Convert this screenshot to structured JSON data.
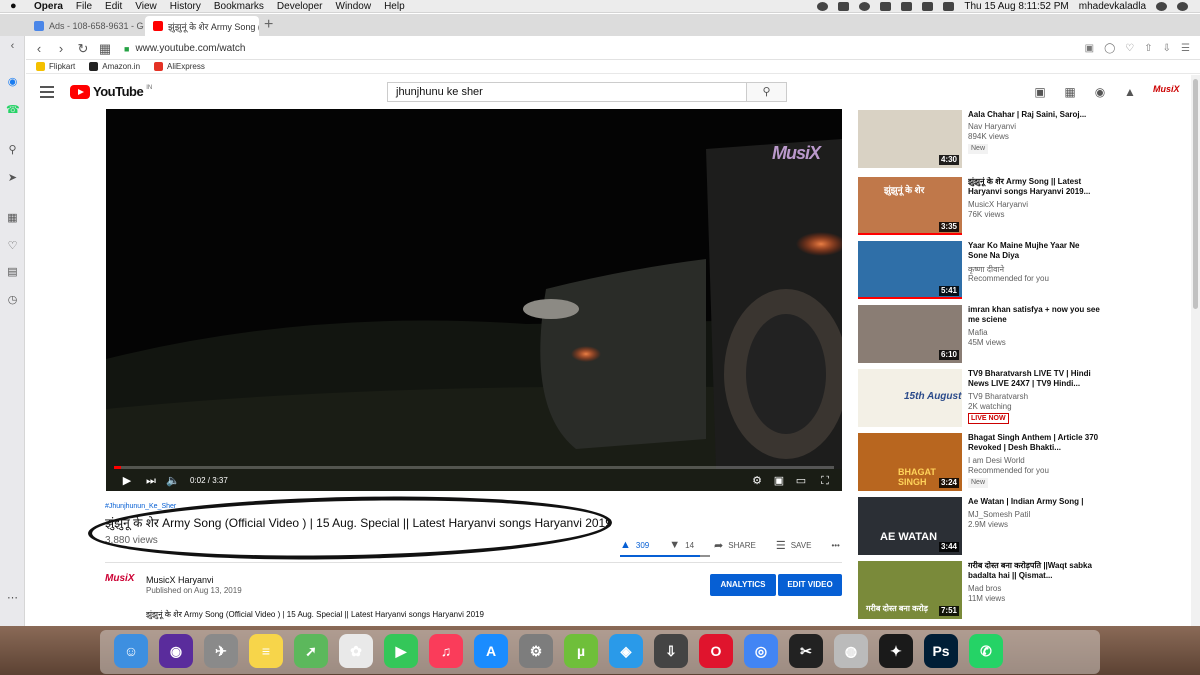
{
  "menubar": {
    "items": [
      "Opera",
      "File",
      "Edit",
      "View",
      "History",
      "Bookmarks",
      "Developer",
      "Window",
      "Help"
    ],
    "datetime": "Thu 15 Aug  8:11:52 PM",
    "user": "mhadevkaladla"
  },
  "tabs": [
    {
      "title": "Ads - 108-658-9631 - Google",
      "icon": "google-ads-icon",
      "active": false
    },
    {
      "title": "झुंझुनूं के शेर Army Song (Official",
      "icon": "youtube-icon",
      "active": true
    }
  ],
  "address": {
    "url": "www.youtube.com/watch"
  },
  "bookmarks": [
    {
      "label": "Flipkart",
      "color": "#f4c000"
    },
    {
      "label": "Amazon.in",
      "color": "#222222"
    },
    {
      "label": "AliExpress",
      "color": "#e43225"
    }
  ],
  "youtube": {
    "logo_text": "YouTube",
    "country": "IN",
    "search_value": "jhunjhunu ke sher",
    "header_icons": [
      "create-video-icon",
      "apps-grid-icon",
      "messages-icon",
      "notifications-bell-icon",
      "account-avatar"
    ]
  },
  "player": {
    "watermark": "MusiX",
    "time_readout": "0:02 / 3:37",
    "progress_fraction": 0.0092
  },
  "video": {
    "hashtag": "#Jhunjhunun_Ke_Sher",
    "title": "झुंझुनूं के शेर Army Song (Official Video ) | 15 Aug. Special || Latest Haryanvi songs Haryanvi 2019",
    "views": "3,880 views",
    "likes": "309",
    "dislikes": "14",
    "share_label": "SHARE",
    "save_label": "SAVE",
    "more_label": "•••",
    "channel_name": "MusicX Haryanvi",
    "published": "Published on Aug 13, 2019",
    "analytics_label": "ANALYTICS",
    "edit_label": "EDIT VIDEO",
    "description": "झुंझुनूं के शेर Army Song (Official Video ) | 15 Aug. Special || Latest Haryanvi songs Haryanvi 2019",
    "avatar_text": "MusiX"
  },
  "recommendations": [
    {
      "title": "Aala Chahar | Raj Saini, Saroj...",
      "channel": "Nav Haryanvi",
      "meta": "894K views",
      "badge": "New",
      "duration": "4:30",
      "thumb_text": "",
      "bg": "#d9d2c4"
    },
    {
      "title": "झुंझुनूं के शेर Army Song || Latest Haryanvi songs Haryanvi 2019...",
      "channel": "MusicX Haryanvi",
      "meta": "76K views",
      "badge": "",
      "duration": "3:35",
      "thumb_text": "झुंझुनूं के शेर",
      "bg": "#c0784a"
    },
    {
      "title": "Yaar Ko Maine Mujhe Yaar Ne Sone Na Diya",
      "channel": "कृष्णा दीवाने",
      "meta": "Recommended for you",
      "badge": "",
      "duration": "5:41",
      "thumb_text": "",
      "bg": "#2f6fa8"
    },
    {
      "title": "imran khan satisfya + now you see me sciene",
      "channel": "Mafia",
      "meta": "45M views",
      "badge": "",
      "duration": "6:10",
      "thumb_text": "",
      "bg": "#8a7d74"
    },
    {
      "title": "TV9 Bharatvarsh LIVE TV | Hindi News LIVE 24X7 | TV9 Hindi...",
      "channel": "TV9 Bharatvarsh",
      "meta": "2K watching",
      "badge": "LIVE NOW",
      "duration": "",
      "thumb_text": "15th August",
      "bg": "#f3f0e6"
    },
    {
      "title": "Bhagat Singh Anthem | Article 370 Revoked | Desh Bhakti...",
      "channel": "I am Desi World",
      "meta": "Recommended for you",
      "badge": "New",
      "duration": "3:24",
      "thumb_text": "BHAGAT SINGH",
      "bg": "#b8661f"
    },
    {
      "title": "Ae Watan | Indian Army Song |",
      "channel": "MJ_Somesh Patil",
      "meta": "2.9M views",
      "badge": "",
      "duration": "3:44",
      "thumb_text": "AE WATAN",
      "bg": "#2b2f35"
    },
    {
      "title": "गरीब दोस्त बना करोड़पति ||Waqt sabka badalta hai || Qismat...",
      "channel": "Mad bros",
      "meta": "11M views",
      "badge": "",
      "duration": "7:51",
      "thumb_text": "गरीब दोस्त बना करोड़",
      "bg": "#7a8a3a"
    }
  ],
  "dock": [
    {
      "name": "finder-icon",
      "color": "#3d8fe0",
      "glyph": "☺"
    },
    {
      "name": "siri-icon",
      "color": "#5a2c9c",
      "glyph": "◉"
    },
    {
      "name": "launchpad-icon",
      "color": "#8a8a8a",
      "glyph": "✈"
    },
    {
      "name": "notes-icon",
      "color": "#f7d54a",
      "glyph": "≡"
    },
    {
      "name": "maps-icon",
      "color": "#5cb85c",
      "glyph": "➚"
    },
    {
      "name": "photos-icon",
      "color": "#e9e9e9",
      "glyph": "✿"
    },
    {
      "name": "facetime-icon",
      "color": "#34c759",
      "glyph": "▶"
    },
    {
      "name": "music-icon",
      "color": "#fa3c5a",
      "glyph": "♫"
    },
    {
      "name": "app-store-icon",
      "color": "#1a8cff",
      "glyph": "A"
    },
    {
      "name": "system-preferences-icon",
      "color": "#7d7d7d",
      "glyph": "⚙"
    },
    {
      "name": "utorrent-icon",
      "color": "#6fbf3a",
      "glyph": "µ"
    },
    {
      "name": "safari-icon",
      "color": "#2a9ae9",
      "glyph": "◈"
    },
    {
      "name": "downloader-icon",
      "color": "#444444",
      "glyph": "⇩"
    },
    {
      "name": "opera-icon",
      "color": "#e0142d",
      "glyph": "O"
    },
    {
      "name": "chrome-icon",
      "color": "#4285f4",
      "glyph": "◎"
    },
    {
      "name": "final-cut-icon",
      "color": "#222222",
      "glyph": "✂"
    },
    {
      "name": "dvd-player-icon",
      "color": "#bbbbbb",
      "glyph": "◍"
    },
    {
      "name": "davinci-resolve-icon",
      "color": "#1a1a1a",
      "glyph": "✦"
    },
    {
      "name": "photoshop-icon",
      "color": "#001e36",
      "glyph": "Ps"
    },
    {
      "name": "whatsapp-icon",
      "color": "#25d366",
      "glyph": "✆"
    }
  ],
  "colors": {
    "youtube_red": "#ff0000",
    "link_blue": "#065fd4"
  }
}
